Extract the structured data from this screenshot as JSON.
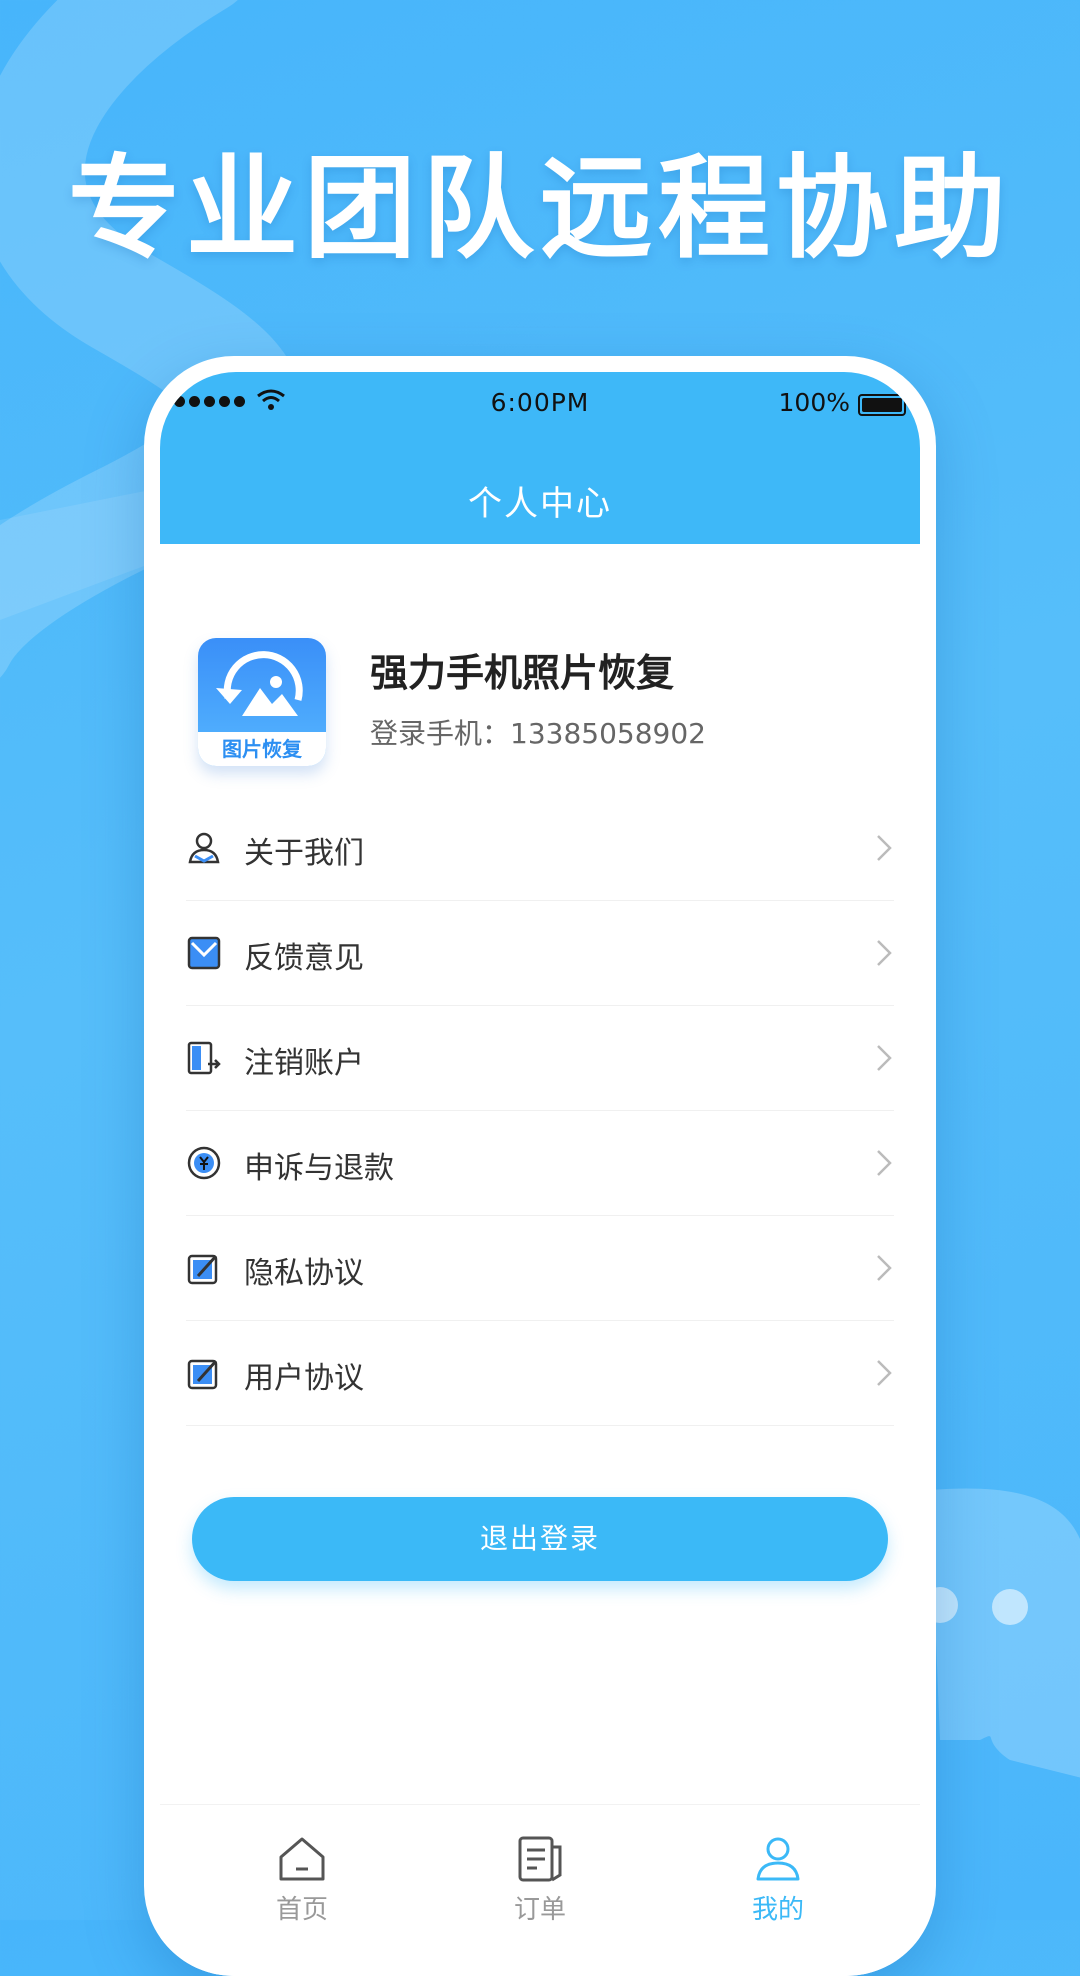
{
  "hero": {
    "title": "专业团队远程协助"
  },
  "status_bar": {
    "time": "6:00PM",
    "battery": "100%"
  },
  "nav": {
    "title": "个人中心"
  },
  "profile": {
    "logo_text": "图片恢复",
    "app_name": "强力手机照片恢复",
    "phone_line": "登录手机：13385058902"
  },
  "menu": [
    {
      "label": "关于我们",
      "icon": "user-icon"
    },
    {
      "label": "反馈意见",
      "icon": "mail-icon"
    },
    {
      "label": "注销账户",
      "icon": "logout-door-icon"
    },
    {
      "label": "申诉与退款",
      "icon": "yuan-coin-icon"
    },
    {
      "label": "隐私协议",
      "icon": "edit-document-icon"
    },
    {
      "label": "用户协议",
      "icon": "edit-document-icon"
    }
  ],
  "logout_button": "退出登录",
  "tabs": [
    {
      "label": "首页",
      "icon": "home-icon",
      "active": false
    },
    {
      "label": "订单",
      "icon": "order-icon",
      "active": false
    },
    {
      "label": "我的",
      "icon": "profile-icon",
      "active": true
    }
  ],
  "colors": {
    "accent": "#3bb9f7",
    "background": "#4ab6fb",
    "text_primary": "#222222",
    "text_secondary": "#666666"
  }
}
